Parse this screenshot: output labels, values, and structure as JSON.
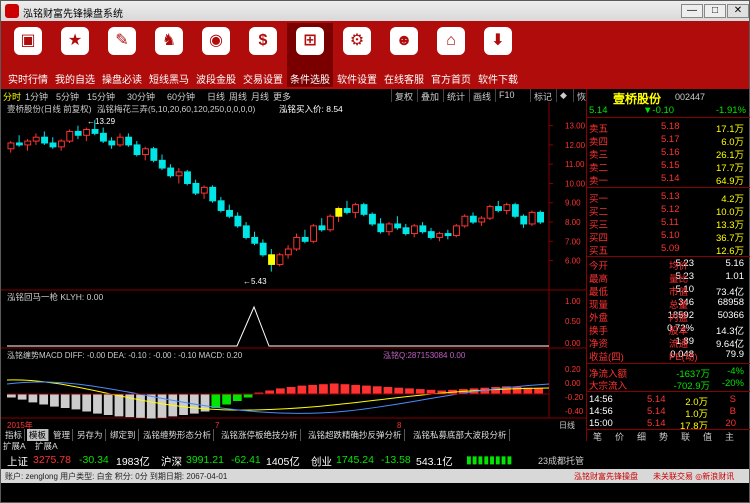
{
  "window": {
    "title": "泓铭财富先锋操盘系统",
    "min": "—",
    "max": "□",
    "close": "✕"
  },
  "toolbar": [
    {
      "label": "实时行情",
      "icon": "monitor-icon",
      "glyph": "▣"
    },
    {
      "label": "我的自选",
      "icon": "star-icon",
      "glyph": "★"
    },
    {
      "label": "操盘必读",
      "icon": "book-icon",
      "glyph": "✎"
    },
    {
      "label": "短线黑马",
      "icon": "horse-icon",
      "glyph": "♞"
    },
    {
      "label": "波段金股",
      "icon": "speaker-icon",
      "glyph": "◉"
    },
    {
      "label": "交易设置",
      "icon": "dollar-icon",
      "glyph": "$"
    },
    {
      "label": "条件选股",
      "icon": "hierarchy-icon",
      "glyph": "⊞"
    },
    {
      "label": "软件设置",
      "icon": "gear-icon",
      "glyph": "⚙"
    },
    {
      "label": "在线客服",
      "icon": "users-icon",
      "glyph": "☻"
    },
    {
      "label": "官方首页",
      "icon": "home-icon",
      "glyph": "⌂"
    },
    {
      "label": "软件下载",
      "icon": "download-icon",
      "glyph": "⬇"
    }
  ],
  "periods": [
    "分时",
    "1分钟",
    "5分钟",
    "15分钟",
    "30分钟",
    "60分钟",
    "日线",
    "周线",
    "月线",
    "更多"
  ],
  "right_tabs": [
    "复权",
    "叠加",
    "统计",
    "画线",
    "F10",
    "标记",
    "◆",
    "恢复"
  ],
  "chart_title": "壹桥股份(日线 前复权)",
  "indicator_main": "泓铭梅花三弄(5,10,20,60,120,250,0,0,0,0)",
  "buy_price_label": "泓铭买入价: 8.54",
  "y_labels": [
    "13.00",
    "12.00",
    "11.00",
    "10.00",
    "9.00",
    "8.00",
    "7.00",
    "6.00"
  ],
  "high_label": "13.29",
  "low_label": "5.43",
  "kdj_label": "泓铭回马一枪 KLYH: 0.00",
  "kdj_y": [
    "1.00",
    "0.50",
    "0.00"
  ],
  "macd_label": "泓铭缠势MACD DIFF: -0.00  DEA: -0.10  : -0.00  : -0.10  MACD: 0.20",
  "macd_extra": "泓铭Q:287153084 0.00",
  "macd_y": [
    "0.20",
    "0.00",
    "-0.20",
    "-0.40"
  ],
  "x_labels": [
    "2015年",
    "7",
    "8"
  ],
  "day_label": "日线",
  "bottom_tabs": [
    "指标",
    "模板",
    "管理",
    "另存为",
    "绑定到",
    "泓铭缠势形态分析",
    "泓铭涨停板绝技分析",
    "泓铭超跌精确抄反弹分析",
    "泓铭私募底部大波段分析"
  ],
  "extra_tabs": [
    "扩展A",
    "扩展A"
  ],
  "quote": {
    "name": "壹桥股份",
    "code": "002447",
    "price": "5.14",
    "change": "▼-0.10",
    "pct": "-1.91%",
    "asks": [
      [
        "卖五",
        "5.18",
        "17.1万"
      ],
      [
        "卖四",
        "5.17",
        "6.0万"
      ],
      [
        "卖三",
        "5.16",
        "26.1万"
      ],
      [
        "卖二",
        "5.15",
        "17.7万"
      ],
      [
        "卖一",
        "5.14",
        "64.9万"
      ]
    ],
    "bids": [
      [
        "买一",
        "5.13",
        "4.2万"
      ],
      [
        "买二",
        "5.12",
        "10.0万"
      ],
      [
        "买三",
        "5.11",
        "13.3万"
      ],
      [
        "买四",
        "5.10",
        "36.7万"
      ],
      [
        "买五",
        "5.09",
        "12.6万"
      ]
    ],
    "stats": [
      [
        "今开",
        "5.23",
        "均价",
        "5.16"
      ],
      [
        "最高",
        "5.23",
        "量比",
        "1.01"
      ],
      [
        "最低",
        "5.10",
        "市值",
        "73.4亿"
      ],
      [
        "现量",
        "346",
        "总量",
        "68958"
      ],
      [
        "外盘",
        "18592",
        "内盘",
        "50366"
      ],
      [
        "换手",
        "0.72%",
        "股本",
        "14.3亿"
      ],
      [
        "净资",
        "1.89",
        "流通",
        "9.64亿"
      ],
      [
        "收益(四)",
        "0.048",
        "PE(动)",
        "79.9"
      ]
    ],
    "flow": [
      [
        "净流入额",
        "-1637万",
        "-4%"
      ],
      [
        "大宗流入",
        "-702.9万",
        "-20%"
      ]
    ],
    "ticks": [
      [
        "14:56",
        "5.14",
        "2.0万",
        "S"
      ],
      [
        "14:56",
        "5.14",
        "1.0万",
        "B"
      ],
      [
        "15:00",
        "5.14",
        "17.8万",
        "20"
      ]
    ],
    "bottom_icons": [
      "笔",
      "价",
      "细",
      "势",
      "联",
      "值",
      "主"
    ]
  },
  "status": {
    "sh_name": "上证",
    "sh": "3275.78",
    "sh_chg": "-30.34",
    "sh_amt": "1983亿",
    "sz_name": "沪深",
    "sz": "3991.21",
    "sz_chg": "-62.41",
    "sz_amt": "1405亿",
    "cy_name": "创业",
    "cy": "1745.24",
    "cy_chg": "-13.58",
    "cy_amt": "543.1亿",
    "broker": "23成都托管"
  },
  "userbar": {
    "left": "账户: zenglong 用户类型: 白金 积分: 0分 到期日期: 2067-04-01",
    "right": "泓铭财富先锋操盘",
    "right2": "未关联交易 ◎新浪财讯"
  },
  "kline": [
    [
      11.8,
      12.2,
      11.6,
      12.1
    ],
    [
      12.1,
      12.5,
      11.9,
      12.0
    ],
    [
      12.0,
      12.3,
      11.7,
      12.2
    ],
    [
      12.2,
      12.6,
      12.0,
      12.4
    ],
    [
      12.4,
      12.7,
      12.0,
      12.1
    ],
    [
      12.1,
      12.4,
      11.8,
      11.9
    ],
    [
      11.9,
      12.3,
      11.7,
      12.2
    ],
    [
      12.2,
      12.8,
      12.1,
      12.7
    ],
    [
      12.7,
      13.0,
      12.3,
      12.5
    ],
    [
      12.5,
      12.9,
      12.2,
      12.8
    ],
    [
      12.8,
      13.29,
      12.5,
      12.6
    ],
    [
      12.6,
      12.9,
      12.1,
      12.2
    ],
    [
      12.2,
      12.4,
      11.8,
      12.0
    ],
    [
      12.0,
      12.6,
      11.9,
      12.4
    ],
    [
      12.4,
      12.6,
      11.9,
      12.0
    ],
    [
      12.0,
      12.2,
      11.4,
      11.5
    ],
    [
      11.5,
      11.9,
      11.2,
      11.8
    ],
    [
      11.8,
      11.9,
      11.1,
      11.2
    ],
    [
      11.2,
      11.5,
      10.7,
      10.8
    ],
    [
      10.8,
      11.0,
      10.3,
      10.4
    ],
    [
      10.4,
      10.8,
      10.0,
      10.6
    ],
    [
      10.6,
      10.7,
      9.9,
      10.0
    ],
    [
      10.0,
      10.2,
      9.4,
      9.5
    ],
    [
      9.5,
      9.9,
      9.2,
      9.8
    ],
    [
      9.8,
      9.9,
      9.0,
      9.1
    ],
    [
      9.1,
      9.3,
      8.5,
      8.6
    ],
    [
      8.6,
      8.9,
      8.2,
      8.3
    ],
    [
      8.3,
      8.5,
      7.7,
      7.8
    ],
    [
      7.8,
      8.0,
      7.1,
      7.2
    ],
    [
      7.2,
      7.5,
      6.8,
      6.9
    ],
    [
      6.9,
      7.1,
      6.2,
      6.3
    ],
    [
      6.3,
      6.6,
      5.43,
      5.8
    ],
    [
      5.8,
      6.4,
      5.7,
      6.3
    ],
    [
      6.3,
      6.8,
      6.1,
      6.6
    ],
    [
      6.6,
      7.4,
      6.5,
      7.2
    ],
    [
      7.2,
      7.6,
      6.9,
      7.0
    ],
    [
      7.0,
      7.9,
      6.9,
      7.8
    ],
    [
      7.8,
      8.2,
      7.5,
      7.6
    ],
    [
      7.6,
      8.4,
      7.5,
      8.3
    ],
    [
      8.3,
      8.8,
      8.0,
      8.7
    ],
    [
      8.7,
      9.1,
      8.4,
      8.5
    ],
    [
      8.5,
      9.0,
      8.2,
      8.9
    ],
    [
      8.9,
      9.0,
      8.3,
      8.4
    ],
    [
      8.4,
      8.5,
      7.8,
      7.9
    ],
    [
      7.9,
      8.2,
      7.4,
      7.5
    ],
    [
      7.5,
      8.0,
      7.3,
      7.9
    ],
    [
      7.9,
      8.3,
      7.6,
      7.7
    ],
    [
      7.7,
      7.9,
      7.3,
      7.4
    ],
    [
      7.4,
      7.9,
      7.2,
      7.8
    ],
    [
      7.8,
      8.0,
      7.4,
      7.5
    ],
    [
      7.5,
      7.7,
      7.1,
      7.2
    ],
    [
      7.2,
      7.5,
      7.0,
      7.4
    ],
    [
      7.4,
      7.6,
      7.1,
      7.3
    ],
    [
      7.3,
      7.9,
      7.2,
      7.8
    ],
    [
      7.8,
      8.4,
      7.7,
      8.3
    ],
    [
      8.3,
      8.5,
      7.9,
      8.0
    ],
    [
      8.0,
      8.3,
      7.8,
      8.2
    ],
    [
      8.2,
      8.9,
      8.1,
      8.8
    ],
    [
      8.8,
      9.1,
      8.5,
      8.6
    ],
    [
      8.6,
      9.0,
      8.4,
      8.9
    ],
    [
      8.9,
      9.0,
      8.2,
      8.3
    ],
    [
      8.3,
      8.4,
      7.7,
      7.9
    ],
    [
      7.9,
      8.6,
      7.8,
      8.5
    ],
    [
      8.5,
      8.6,
      7.9,
      8.0
    ]
  ],
  "macd_bars": [
    -0.05,
    -0.08,
    -0.12,
    -0.15,
    -0.18,
    -0.2,
    -0.22,
    -0.25,
    -0.28,
    -0.3,
    -0.32,
    -0.33,
    -0.34,
    -0.35,
    -0.34,
    -0.32,
    -0.3,
    -0.28,
    -0.25,
    -0.2,
    -0.15,
    -0.1,
    -0.05,
    0.02,
    0.05,
    0.08,
    0.1,
    0.12,
    0.13,
    0.14,
    0.15,
    0.14,
    0.13,
    0.12,
    0.11,
    0.1,
    0.09,
    0.08,
    0.07,
    0.06,
    0.05,
    0.06,
    0.07,
    0.08,
    0.09,
    0.1,
    0.11,
    0.1,
    0.09,
    0.08
  ]
}
